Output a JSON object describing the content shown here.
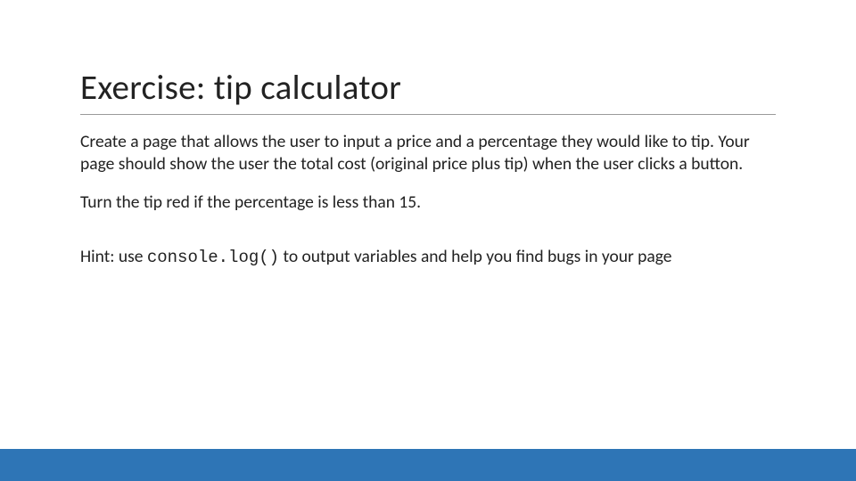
{
  "title": "Exercise: tip calculator",
  "paragraph1": "Create a page that allows the user to input a price and a percentage they would like to tip. Your page should show the user the total cost (original price plus tip) when the user clicks a button.",
  "paragraph2": "Turn the tip red if the percentage is less than 15.",
  "hint_prefix": "Hint: use ",
  "hint_code": "console.log()",
  "hint_suffix": " to output variables and help you find bugs in your page",
  "footer_color": "#2E75B6"
}
